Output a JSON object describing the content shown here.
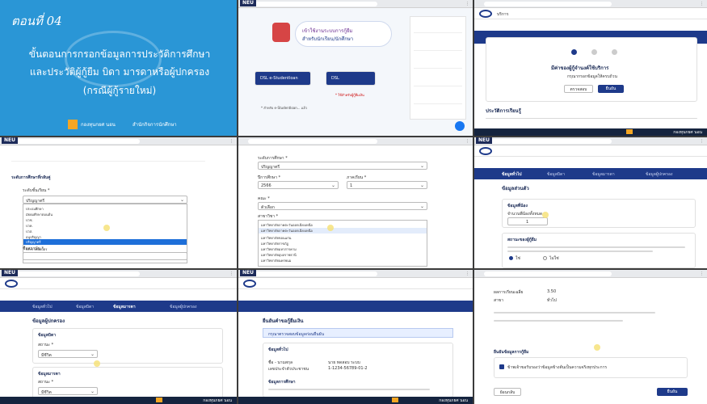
{
  "title_card": {
    "episode": "ตอนที่ 04",
    "heading_line1": "ขั้นตอนการกรอกข้อมูลการประวัติการศึกษา",
    "heading_line2": "และประวัติผู้กู้ยืม บิดา มารดาหรือผู้ปกครอง",
    "heading_line3": "(กรณีผู้กู้รายใหม่)",
    "fund_name": "กองทุนกยศ นอน",
    "office_name": "สำนักกิจการนักศึกษา",
    "accent_color": "#2a96d6",
    "title_color": "#f5c200"
  },
  "neu_label": "NEU",
  "panel2": {
    "banner_line1": "เข้าใช้งานระบบการกู้ยืม",
    "banner_line2": "สำหรับนักเรียน/นักศึกษา",
    "card_left": "DSL e-Studentloan",
    "card_right": "DSL",
    "caption_left": "* สำหรับ e-Studentloan... แล้ว",
    "caption_right": "* ใช้สำหรับผู้กู้ยืมเงิน"
  },
  "panel3": {
    "nav_item": "บริการ",
    "heading": "มีค่าของผู้กู้จำนงค์ใช้บริการ",
    "sub": "กรุณากรอกข้อมูลให้ครบถ้วน",
    "btn_outline": "ตรวจสอบ",
    "btn_primary": "ยืนยัน",
    "section": "ประวัติการเรียนรู้"
  },
  "panel4": {
    "section": "ระดับการศึกษาที่กลับคู่",
    "label": "ระดับชั้นเรียน *",
    "value": "ปริญญาตรี",
    "options": [
      "ประถมศึกษา",
      "มัธยมศึกษาตอนต้น",
      "ปวช.",
      "ปวท.",
      "ปวส.",
      "อนุปริญญา",
      "ปริญญาตรี",
      "ประกาศนียบัตร",
      "ปริญญาโท"
    ],
    "label2": "ชื่อสถาบัน *"
  },
  "panel5": {
    "label1": "ระดับการศึกษา *",
    "value1": "ปริญญาตรี",
    "label2": "ปีการศึกษา *",
    "value2": "2566",
    "label3": "ภาคเรียน *",
    "value3": "1",
    "label4": "คณะ *",
    "value4": "ตัวเลือก",
    "label5": "สาขาวิชา *",
    "options": [
      "มหาวิทยาลัยภาคตะวันออกเฉียงเหนือ",
      "มหาวิทยาลัยภาคตะวันออกเฉียงเหนือ",
      "มหาวิทยาลัยขอนแก่น",
      "มหาวิทยาลัยราชภัฏ",
      "มหาวิทยาลัยมหาสารคาม",
      "มหาวิทยาลัยอุบลราชธานี",
      "มหาวิทยาลัยนครพนม"
    ]
  },
  "panel6": {
    "tabs": [
      "ข้อมูลทั่วไป",
      "ข้อมูลบิดา",
      "ข้อมูลมารดา",
      "ข้อมูลผู้ปกครอง"
    ],
    "heading": "ข้อมูลส่วนตัว",
    "box_title": "ข้อมูลพี่น้อง",
    "row_label": "จำนวนพี่น้องทั้งหมด",
    "row_value": "1",
    "box2_title": "สถานะของผู้กู้ยืม",
    "radio_yes": "ใช่",
    "radio_no": "ไม่ใช่"
  },
  "panel7": {
    "tabs": [
      "ข้อมูลทั่วไป",
      "ข้อมูลบิดา",
      "ข้อมูลมารดา",
      "ข้อมูลผู้ปกครอง"
    ],
    "heading": "ข้อมูลผู้ปกครอง",
    "section1": "ข้อมูลบิดา",
    "field1_label": "สถานะ *",
    "field1_value": "มีชีวิต",
    "section2": "ข้อมูลมารดา",
    "field2_label": "สถานะ *",
    "field2_value": "มีชีวิต"
  },
  "panel8": {
    "heading": "ยืนยันคำขอกู้ยืมเงิน",
    "notice": "กรุณาตรวจสอบข้อมูลก่อนยืนยัน",
    "section1": "ข้อมูลทั่วไป",
    "row1_label": "ชื่อ - นามสกุล",
    "row1_value": "นาย ทดสอบ ระบบ",
    "row2_label": "เลขประจำตัวประชาชน",
    "row2_value": "1-1234-56789-01-2",
    "section2": "ข้อมูลการศึกษา"
  },
  "panel9": {
    "row1_label": "ผลการเรียนเฉลี่ย",
    "row1_value": "3.50",
    "row2_label": "สาขา",
    "row2_value": "ทั่วไป",
    "section": "ยืนยันข้อมูลการกู้ยืม",
    "consent": "ข้าพเจ้าขอรับรองว่าข้อมูลข้างต้นเป็นความจริงทุกประการ",
    "btn_back": "ย้อนกลับ",
    "btn_submit": "ยืนยัน"
  },
  "footer_text": "กองทุนกยศ นอน"
}
